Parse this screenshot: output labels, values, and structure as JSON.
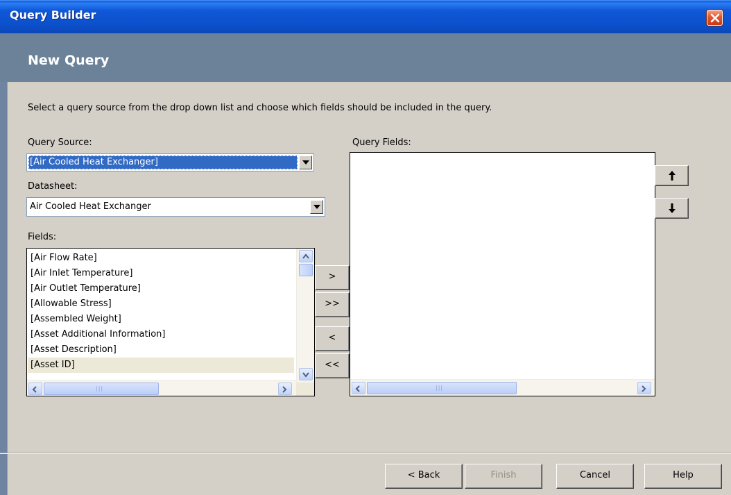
{
  "window": {
    "title": "Query Builder"
  },
  "header": {
    "title": "New Query"
  },
  "instructions": "Select a query source from the drop down list and choose which fields should be included in the query.",
  "query_source": {
    "label": "Query Source:",
    "value": "[Air Cooled Heat Exchanger]"
  },
  "datasheet": {
    "label": "Datasheet:",
    "value": "Air Cooled Heat Exchanger"
  },
  "fields": {
    "label": "Fields:",
    "items": [
      "[Air Flow Rate]",
      "[Air Inlet Temperature]",
      "[Air Outlet Temperature]",
      "[Allowable Stress]",
      "[Assembled Weight]",
      "[Asset Additional Information]",
      "[Asset Description]",
      "[Asset ID]"
    ],
    "highlighted": "[Asset ID]"
  },
  "query_fields": {
    "label": "Query Fields:",
    "items": []
  },
  "transfer_buttons": {
    "add": ">",
    "add_all": ">>",
    "remove": "<",
    "remove_all": "<<"
  },
  "footer": {
    "back": "< Back",
    "finish": "Finish",
    "cancel": "Cancel",
    "help": "Help"
  },
  "icons": {
    "close": "close-icon",
    "move_up": "arrow-up-icon",
    "move_down": "arrow-down-icon"
  },
  "colors": {
    "titlebar": "#0c50cc",
    "header_band": "#6b8299",
    "selection": "#316ac5",
    "dialog_bg": "#d4d0c8"
  }
}
